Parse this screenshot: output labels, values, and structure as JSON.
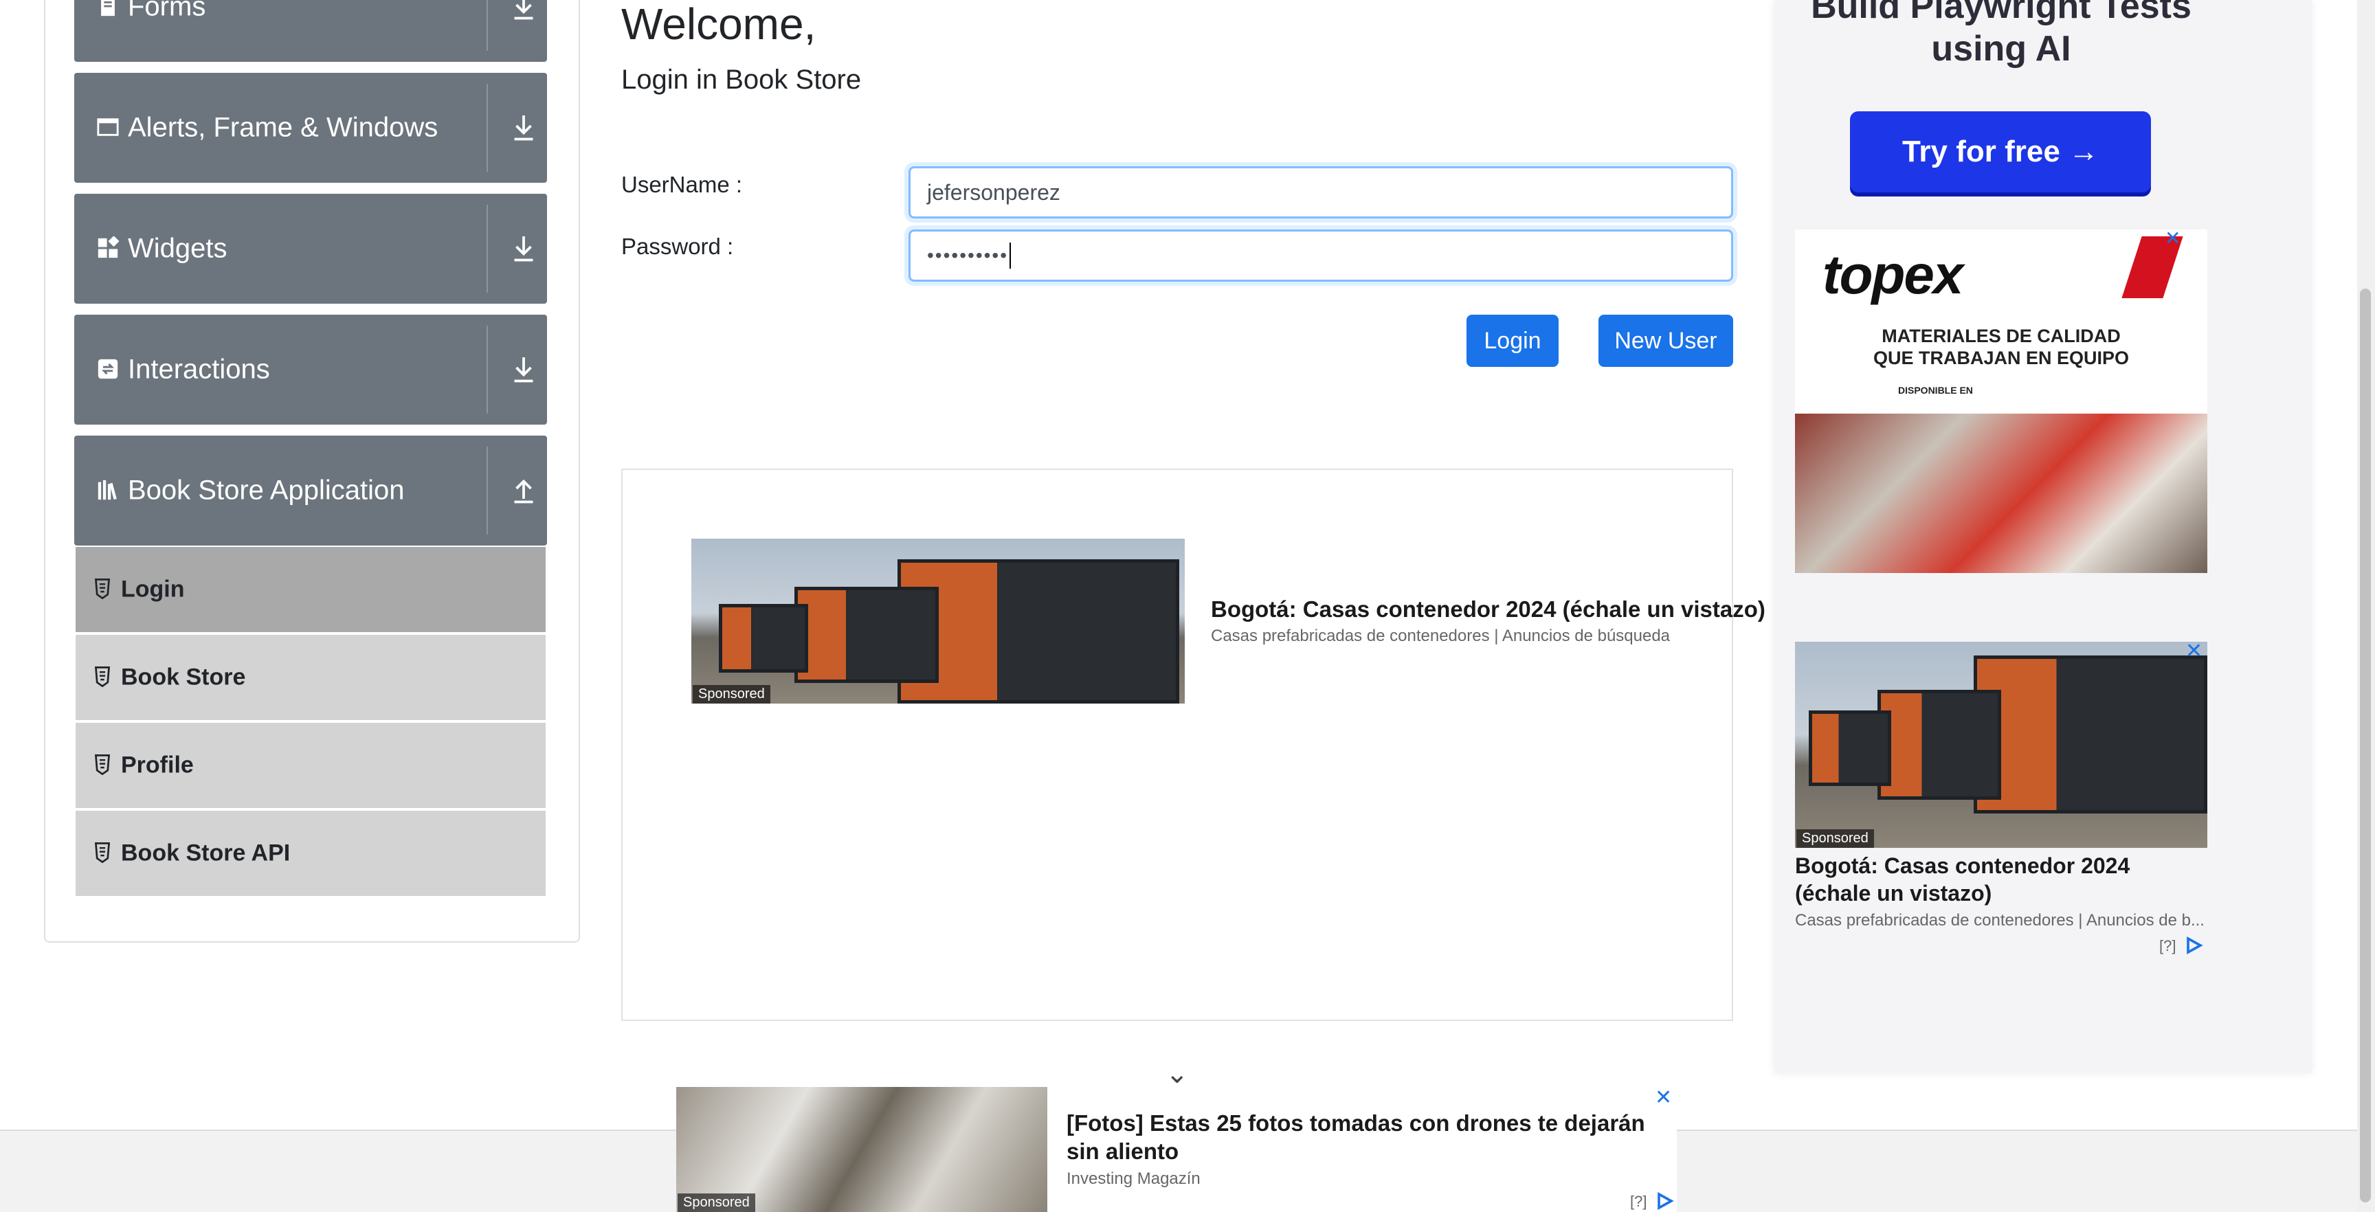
{
  "sidebar": {
    "groups": [
      {
        "label": "Forms",
        "icon": "document-icon",
        "state": "collapsed"
      },
      {
        "label": "Alerts, Frame & Windows",
        "icon": "window-icon",
        "state": "collapsed"
      },
      {
        "label": "Widgets",
        "icon": "widgets-icon",
        "state": "collapsed"
      },
      {
        "label": "Interactions",
        "icon": "interactions-icon",
        "state": "collapsed"
      },
      {
        "label": "Book Store Application",
        "icon": "books-icon",
        "state": "expanded"
      }
    ],
    "items": [
      {
        "label": "Login",
        "active": true
      },
      {
        "label": "Book Store",
        "active": false
      },
      {
        "label": "Profile",
        "active": false
      },
      {
        "label": "Book Store API",
        "active": false
      }
    ]
  },
  "main": {
    "welcome": "Welcome,",
    "subtitle": "Login in Book Store",
    "username_label": "UserName :",
    "username_value": "jefersonperez",
    "password_label": "Password :",
    "password_value": "••••••••••",
    "login_button": "Login",
    "new_user_button": "New User"
  },
  "center_ad": {
    "title": "Bogotá: Casas contenedor 2024 (échale un vistazo)",
    "subtitle": "Casas prefabricadas de contenedores | Anuncios de búsqueda",
    "sponsored": "Sponsored"
  },
  "right_ads": {
    "playwright_title": "Build Playwright Tests using AI",
    "try_button": "Try for free →",
    "topex_brand": "topex",
    "topex_line1": "MATERIALES DE CALIDAD",
    "topex_line2": "QUE TRABAJAN EN EQUIPO",
    "topex_line3": "DISPONIBLE EN",
    "container_title": "Bogotá: Casas contenedor 2024 (échale un vistazo)",
    "container_subtitle": "Casas prefabricadas de contenedores | Anuncios de b...",
    "sponsored": "Sponsored",
    "help": "[?]",
    "close": "✕"
  },
  "bottom_ad": {
    "title": "[Fotos] Estas 25 fotos tomadas con drones te dejarán sin aliento",
    "source": "Investing Magazín",
    "sponsored": "Sponsored",
    "help": "[?]",
    "close": "✕",
    "collapse_glyph": "⌄"
  },
  "colors": {
    "sidebar_group": "#6c757d",
    "sidebar_item": "#d3d3d3",
    "sidebar_item_active": "#a9a9a9",
    "primary_button": "#1a73e8",
    "ad_cta": "#1d36e8"
  }
}
